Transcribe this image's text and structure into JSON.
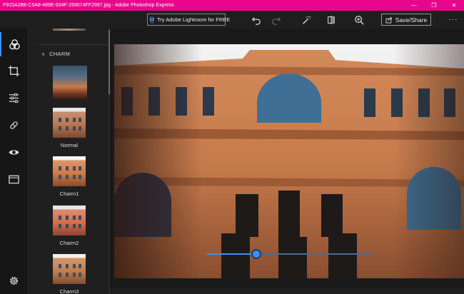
{
  "window": {
    "title": "F915A2B8-C5A8-489E-934F-269674FF2997.jpg - Adobe Photoshop Express",
    "minimize_glyph": "—",
    "maximize_glyph": "❐",
    "close_glyph": "✕",
    "title_bar_color": "#e8068c"
  },
  "toolbar": {
    "lightroom_badge": "Lr",
    "lightroom_label": "Try Adobe Lightroom for FREE",
    "undo_icon": "undo-icon",
    "redo_icon": "redo-icon",
    "auto_fix_icon": "magic-wand-icon",
    "compare_icon": "compare-icon",
    "zoom_icon": "zoom-in-icon",
    "save_label": "Save/Share",
    "more_glyph": "···"
  },
  "rail": {
    "items": [
      {
        "icon": "looks-icon",
        "active": true
      },
      {
        "icon": "crop-icon",
        "active": false
      },
      {
        "icon": "adjustments-icon",
        "active": false
      },
      {
        "icon": "healing-icon",
        "active": false
      },
      {
        "icon": "red-eye-icon",
        "active": false
      },
      {
        "icon": "borders-icon",
        "active": false
      }
    ],
    "settings_icon": "gear-icon",
    "accent_color": "#3c8ff5"
  },
  "panel": {
    "category_label": "CHARM",
    "filters": [
      {
        "label": "Normal"
      },
      {
        "label": "Charm1"
      },
      {
        "label": "Charm2"
      },
      {
        "label": "Charm3"
      }
    ]
  },
  "slider": {
    "value_fraction": 0.3
  }
}
